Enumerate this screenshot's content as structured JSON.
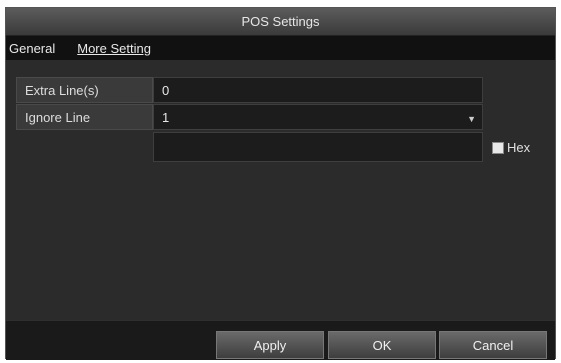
{
  "dialog": {
    "title": "POS Settings"
  },
  "tabs": [
    {
      "label": "General",
      "active": false
    },
    {
      "label": "More Setting",
      "active": true
    }
  ],
  "fields": {
    "extra_lines": {
      "label": "Extra Line(s)",
      "value": "0"
    },
    "ignore_line": {
      "label": "Ignore Line",
      "value": "1"
    },
    "ignore_text": {
      "value": ""
    }
  },
  "hex": {
    "label": "Hex",
    "checked": false
  },
  "buttons": {
    "apply": "Apply",
    "ok": "OK",
    "cancel": "Cancel"
  },
  "icons": {
    "dropdown": "chevron-down-icon"
  },
  "colors": {
    "title_bar": "#4a4a4a",
    "content_bg": "#2b2b2b",
    "footer_bg": "#1a1a1a"
  }
}
